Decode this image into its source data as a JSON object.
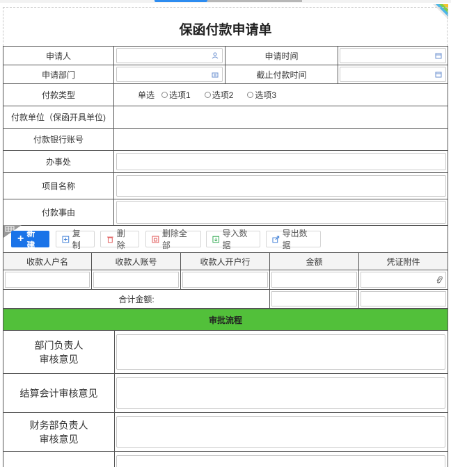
{
  "form": {
    "title": "保函付款申请单"
  },
  "fields": {
    "applicant_label": "申请人",
    "apply_time_label": "申请时间",
    "dept_label": "申请部门",
    "deadline_label": "截止付款时间",
    "pay_type_label": "付款类型",
    "pay_type_prefix": "单选",
    "pay_type_options": [
      "选项1",
      "选项2",
      "选项3"
    ],
    "payer_unit_label": "付款单位（保函开具单位)",
    "bank_account_label": "付款银行账号",
    "office_label": "办事处",
    "project_label": "项目名称",
    "reason_label": "付款事由"
  },
  "toolbar": {
    "new_label": "新建",
    "copy_label": "复制",
    "delete_label": "删除",
    "delete_all_label": "删除全部",
    "import_label": "导入数据",
    "export_label": "导出数据"
  },
  "grid": {
    "columns": [
      "收款人户名",
      "收款人账号",
      "收款人开户行",
      "金额",
      "凭证附件"
    ],
    "total_label": "合计金额:"
  },
  "approval": {
    "title": "审批流程",
    "dept_head": [
      "部门负责人",
      "审核意见"
    ],
    "accounting": "结算会计审核意见",
    "finance_head": [
      "财务部负责人",
      "审核意见"
    ]
  },
  "colors": {
    "accent": "#1a73e8",
    "approval_bar": "#52c03a",
    "border": "#555555"
  }
}
